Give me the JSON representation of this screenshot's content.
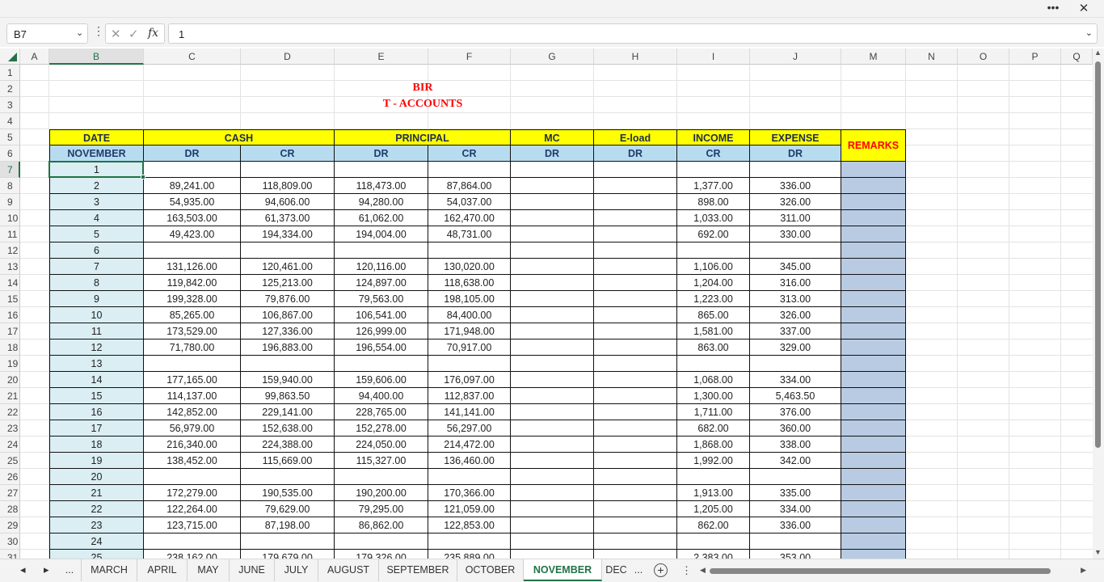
{
  "window": {
    "more_icon": "more-horizontal-icon",
    "close_icon": "close-icon"
  },
  "formula_bar": {
    "name_box": "B7",
    "value": "1"
  },
  "columns": [
    "A",
    "B",
    "C",
    "D",
    "E",
    "F",
    "G",
    "H",
    "I",
    "J",
    "M",
    "N",
    "O",
    "P",
    "Q"
  ],
  "rows": [
    "1",
    "2",
    "3",
    "4",
    "5",
    "6",
    "7",
    "8",
    "9",
    "10",
    "11",
    "12",
    "13",
    "14",
    "15",
    "16",
    "17",
    "18",
    "19",
    "20",
    "21",
    "22",
    "23",
    "24",
    "25",
    "26",
    "27",
    "28",
    "29",
    "30",
    "31"
  ],
  "titles": {
    "line1": "BIR",
    "line2": "T - ACCOUNTS"
  },
  "headers": {
    "date": "DATE",
    "cash": "CASH",
    "principal": "PRINCIPAL",
    "mc": "MC",
    "eload": "E-load",
    "income": "INCOME",
    "expense": "EXPENSE",
    "remarks": "REMARKS",
    "month": "NOVEMBER",
    "sub": [
      "DR",
      "CR",
      "DR",
      "CR",
      "DR",
      "DR",
      "CR",
      "DR"
    ]
  },
  "table": [
    {
      "day": "1",
      "c": "",
      "d": "",
      "e": "",
      "f": "",
      "i": "",
      "j": ""
    },
    {
      "day": "2",
      "c": "89,241.00",
      "d": "118,809.00",
      "e": "118,473.00",
      "f": "87,864.00",
      "i": "1,377.00",
      "j": "336.00"
    },
    {
      "day": "3",
      "c": "54,935.00",
      "d": "94,606.00",
      "e": "94,280.00",
      "f": "54,037.00",
      "i": "898.00",
      "j": "326.00"
    },
    {
      "day": "4",
      "c": "163,503.00",
      "d": "61,373.00",
      "e": "61,062.00",
      "f": "162,470.00",
      "i": "1,033.00",
      "j": "311.00"
    },
    {
      "day": "5",
      "c": "49,423.00",
      "d": "194,334.00",
      "e": "194,004.00",
      "f": "48,731.00",
      "i": "692.00",
      "j": "330.00"
    },
    {
      "day": "6",
      "c": "",
      "d": "",
      "e": "",
      "f": "",
      "i": "",
      "j": ""
    },
    {
      "day": "7",
      "c": "131,126.00",
      "d": "120,461.00",
      "e": "120,116.00",
      "f": "130,020.00",
      "i": "1,106.00",
      "j": "345.00"
    },
    {
      "day": "8",
      "c": "119,842.00",
      "d": "125,213.00",
      "e": "124,897.00",
      "f": "118,638.00",
      "i": "1,204.00",
      "j": "316.00"
    },
    {
      "day": "9",
      "c": "199,328.00",
      "d": "79,876.00",
      "e": "79,563.00",
      "f": "198,105.00",
      "i": "1,223.00",
      "j": "313.00"
    },
    {
      "day": "10",
      "c": "85,265.00",
      "d": "106,867.00",
      "e": "106,541.00",
      "f": "84,400.00",
      "i": "865.00",
      "j": "326.00"
    },
    {
      "day": "11",
      "c": "173,529.00",
      "d": "127,336.00",
      "e": "126,999.00",
      "f": "171,948.00",
      "i": "1,581.00",
      "j": "337.00"
    },
    {
      "day": "12",
      "c": "71,780.00",
      "d": "196,883.00",
      "e": "196,554.00",
      "f": "70,917.00",
      "i": "863.00",
      "j": "329.00"
    },
    {
      "day": "13",
      "c": "",
      "d": "",
      "e": "",
      "f": "",
      "i": "",
      "j": ""
    },
    {
      "day": "14",
      "c": "177,165.00",
      "d": "159,940.00",
      "e": "159,606.00",
      "f": "176,097.00",
      "i": "1,068.00",
      "j": "334.00"
    },
    {
      "day": "15",
      "c": "114,137.00",
      "d": "99,863.50",
      "e": "94,400.00",
      "f": "112,837.00",
      "i": "1,300.00",
      "j": "5,463.50"
    },
    {
      "day": "16",
      "c": "142,852.00",
      "d": "229,141.00",
      "e": "228,765.00",
      "f": "141,141.00",
      "i": "1,711.00",
      "j": "376.00"
    },
    {
      "day": "17",
      "c": "56,979.00",
      "d": "152,638.00",
      "e": "152,278.00",
      "f": "56,297.00",
      "i": "682.00",
      "j": "360.00"
    },
    {
      "day": "18",
      "c": "216,340.00",
      "d": "224,388.00",
      "e": "224,050.00",
      "f": "214,472.00",
      "i": "1,868.00",
      "j": "338.00"
    },
    {
      "day": "19",
      "c": "138,452.00",
      "d": "115,669.00",
      "e": "115,327.00",
      "f": "136,460.00",
      "i": "1,992.00",
      "j": "342.00"
    },
    {
      "day": "20",
      "c": "",
      "d": "",
      "e": "",
      "f": "",
      "i": "",
      "j": ""
    },
    {
      "day": "21",
      "c": "172,279.00",
      "d": "190,535.00",
      "e": "190,200.00",
      "f": "170,366.00",
      "i": "1,913.00",
      "j": "335.00"
    },
    {
      "day": "22",
      "c": "122,264.00",
      "d": "79,629.00",
      "e": "79,295.00",
      "f": "121,059.00",
      "i": "1,205.00",
      "j": "334.00"
    },
    {
      "day": "23",
      "c": "123,715.00",
      "d": "87,198.00",
      "e": "86,862.00",
      "f": "122,853.00",
      "i": "862.00",
      "j": "336.00"
    },
    {
      "day": "24",
      "c": "",
      "d": "",
      "e": "",
      "f": "",
      "i": "",
      "j": ""
    },
    {
      "day": "25",
      "c": "238,162.00",
      "d": "179,679.00",
      "e": "179,326.00",
      "f": "235,889.00",
      "i": "2,383.00",
      "j": "353.00"
    }
  ],
  "tabs": [
    "...",
    "MARCH",
    "APRIL",
    "MAY",
    "JUNE",
    "JULY",
    "AUGUST",
    "SEPTEMBER",
    "OCTOBER",
    "NOVEMBER",
    "DEC",
    "..."
  ],
  "active_tab": "NOVEMBER",
  "colors": {
    "accent": "#217346",
    "header_yellow": "#ffff00",
    "header_blue": "#b8dcef",
    "title_red": "#ff0000"
  }
}
